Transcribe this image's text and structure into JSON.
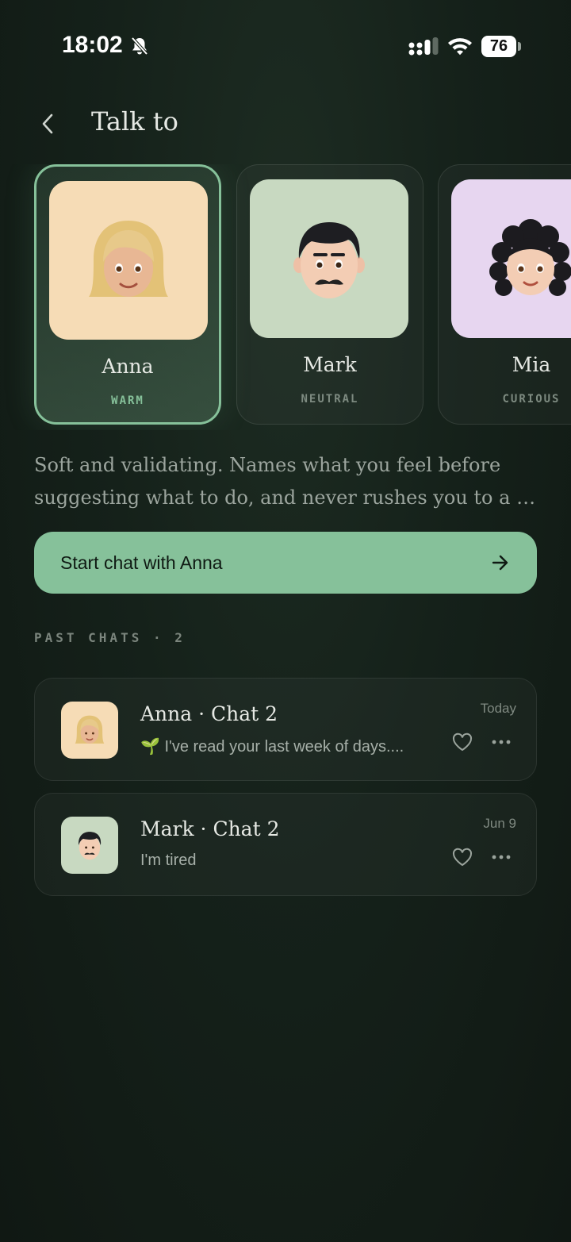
{
  "status_bar": {
    "time": "18:02",
    "battery": "76"
  },
  "header": {
    "title": "Talk to"
  },
  "companions": [
    {
      "name": "Anna",
      "tag": "WARM",
      "selected": true,
      "avatar_bg": "#f6dcb6"
    },
    {
      "name": "Mark",
      "tag": "NEUTRAL",
      "selected": false,
      "avatar_bg": "#c8d9c1"
    },
    {
      "name": "Mia",
      "tag": "CURIOUS",
      "selected": false,
      "avatar_bg": "#e7d6f0"
    }
  ],
  "description": {
    "line1": "Soft and validating. Names what you feel before",
    "line2": "suggesting what to do, and never rushes you to a concl..."
  },
  "start_button": {
    "label": "Start chat with Anna"
  },
  "past_chats": {
    "heading": "PAST CHATS · 2",
    "items": [
      {
        "title": "Anna · Chat 2",
        "preview": "🌱 I've read your last week of days....",
        "date": "Today"
      },
      {
        "title": "Mark · Chat 2",
        "preview": "I'm tired",
        "date": "Jun 9"
      }
    ]
  },
  "colors": {
    "accent": "#86c19a",
    "background": "#131d16"
  }
}
